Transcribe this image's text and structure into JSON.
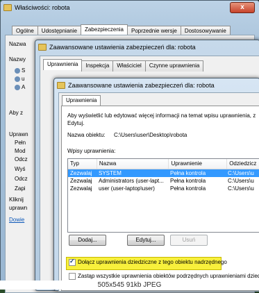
{
  "win1": {
    "title": "Właściwości: robota",
    "close": "x",
    "tabs": [
      "Ogólne",
      "Udostępnianie",
      "Zabezpieczenia",
      "Poprzednie wersje",
      "Dostosowywanie"
    ],
    "side": [
      "Nazwa",
      "Nazwy",
      "S",
      "u",
      "A",
      "Aby z",
      "Uprawn",
      "Pełn",
      "Mod",
      "Odcz",
      "Wyś",
      "Odcz",
      "Zapi",
      "Kliknij",
      "uprawn",
      "Dowie"
    ]
  },
  "win2": {
    "title": "Zaawansowane ustawienia zabezpieczeń dla: robota",
    "tabs": [
      "Uprawnienia",
      "Inspekcja",
      "Właściciel",
      "Czynne uprawnienia"
    ]
  },
  "win3": {
    "title": "Zaawansowane ustawienia zabezpieczeń dla: robota",
    "tab": "Uprawnienia",
    "info": "Aby wyświetlić lub edytować więcej informacji na temat wpisu uprawnienia, zaznacz wpis i kliknij przycisk Edytuj.",
    "info1": "Aby wyświetlić lub edytować więcej informacji na temat wpisu uprawnienia, z",
    "info2": "Edytuj.",
    "object_label": "Nazwa obiektu:",
    "object_value": "C:\\Users\\user\\Desktop\\robota",
    "entries_label": "Wpisy uprawnienia:",
    "columns": [
      "Typ",
      "Nazwa",
      "Uprawnienie",
      "Odziedzicz"
    ],
    "rows": [
      {
        "type": "Zezwalaj",
        "name": "SYSTEM",
        "perm": "Pełna kontrola",
        "inh": "C:\\Users\\u"
      },
      {
        "type": "Zezwalaj",
        "name": "Administrators (user-lapt...",
        "perm": "Pełna kontrola",
        "inh": "C:\\Users\\u"
      },
      {
        "type": "Zezwalaj",
        "name": "user (user-laptop\\user)",
        "perm": "Pełna kontrola",
        "inh": "C:\\Users\\u"
      }
    ],
    "btn_add": "Dodaj...",
    "btn_edit": "Edytuj...",
    "btn_remove": "Usuń",
    "chk_inherit": "Dołącz uprawnienia dziedziczne z tego obiektu nadrzędnego",
    "chk_replace": "Zastąp wszystkie uprawnienia obiektów podrzędnych uprawnieniami dziedz"
  },
  "caption": "505x545 91kb JPEG"
}
